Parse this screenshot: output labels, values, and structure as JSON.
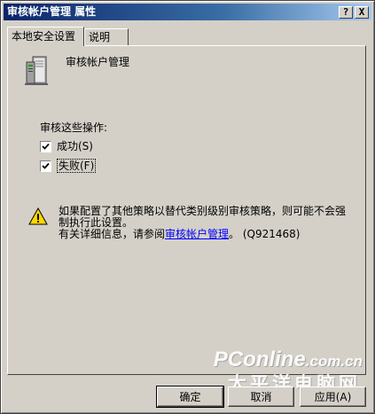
{
  "window": {
    "title": "审核帐户管理 属性",
    "help_button": "?",
    "close_button": "X"
  },
  "tabs": [
    {
      "label": "本地安全设置",
      "active": true
    },
    {
      "label": "说明",
      "active": false
    }
  ],
  "policy": {
    "name": "审核帐户管理",
    "icon": "server-icon"
  },
  "audit": {
    "label": "审核这些操作:",
    "success": {
      "label": "成功(S)",
      "checked": true
    },
    "failure": {
      "label": "失败(F)",
      "checked": true
    }
  },
  "warning": {
    "icon": "warning-icon",
    "line1": "如果配置了其他策略以替代类别级别审核策略，则可能不会强制执行此设置。",
    "line2_prefix": "有关详细信息，请参阅",
    "link": "审核帐户管理",
    "line2_suffix": "。 (Q921468)"
  },
  "watermark": {
    "logo_main": "PConline",
    "logo_domain": ".com.cn",
    "subtitle": "太平洋电脑网"
  },
  "buttons": {
    "ok": "确定",
    "cancel": "取消",
    "apply": "应用(A)"
  }
}
